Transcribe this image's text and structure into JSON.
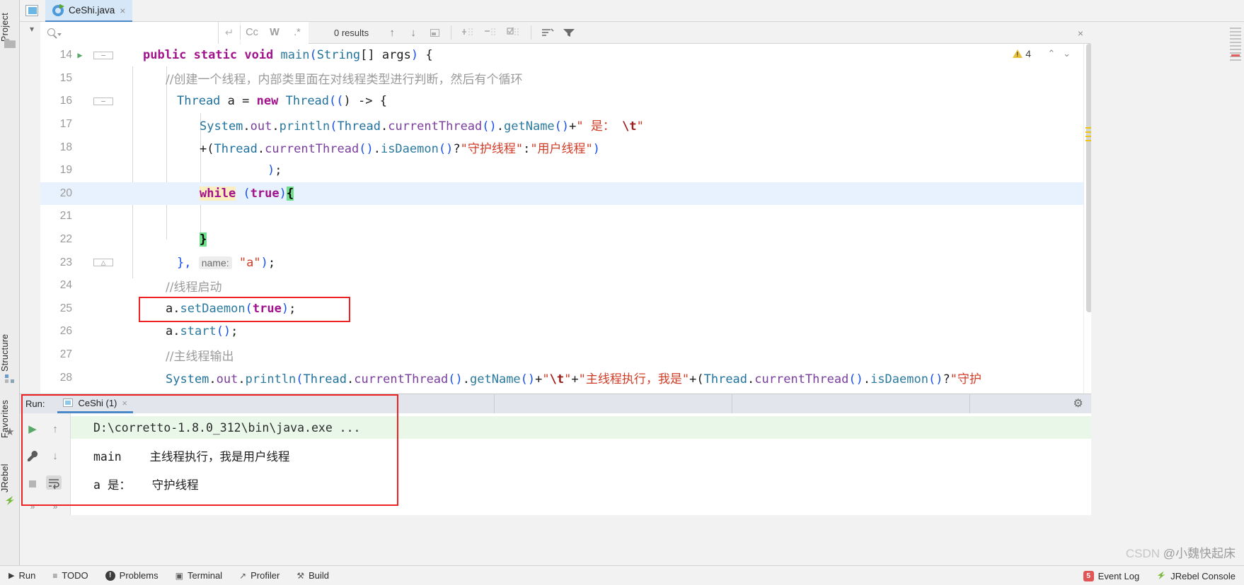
{
  "window": {
    "left_strip": {
      "project_label": "Project",
      "structure_label": "Structure",
      "favorites_label": "Favorites",
      "jrebel_label": "JRebel"
    }
  },
  "tabs": [
    {
      "label": "CeShi.java",
      "close": "×",
      "active": true
    }
  ],
  "find_toolbar": {
    "search_value": "",
    "search_placeholder": "",
    "return_icon": "↵",
    "match_case": "Cc",
    "words": "W",
    "regex": ".*",
    "results": "0 results",
    "prev_icon": "↑",
    "next_icon": "↓",
    "select_in_scope_icon": "▢",
    "add_line_icon": "+",
    "remove_line_icon": "−",
    "toggle_line_icon": "☑",
    "filter_list_icon": "≡",
    "filter_icon": "▼",
    "close_icon": "×"
  },
  "editor": {
    "warning_count": "4",
    "warning_up": "⌃",
    "warning_down": "⌄",
    "lines": [
      {
        "no": "14",
        "run_marker": "▶",
        "fold": "−",
        "indent": 0,
        "highlight": false,
        "tokens": [
          {
            "t": "public",
            "c": "kw"
          },
          {
            "t": " ",
            "c": "op"
          },
          {
            "t": "static",
            "c": "kw"
          },
          {
            "t": " ",
            "c": "op"
          },
          {
            "t": "void",
            "c": "kw"
          },
          {
            "t": " ",
            "c": "op"
          },
          {
            "t": "main",
            "c": "mth"
          },
          {
            "t": "(",
            "c": "brk"
          },
          {
            "t": "String",
            "c": "ty"
          },
          {
            "t": "[] ",
            "c": "op"
          },
          {
            "t": "args",
            "c": "id"
          },
          {
            "t": ")",
            "c": "brk"
          },
          {
            "t": " {",
            "c": "op"
          }
        ]
      },
      {
        "no": "15",
        "run_marker": "",
        "fold": "",
        "indent": 1,
        "highlight": false,
        "tokens": [
          {
            "t": "//创建一个线程，内部类里面在对线程类型进行判断，然后有个循环",
            "c": "cmt"
          }
        ]
      },
      {
        "no": "16",
        "run_marker": "",
        "fold": "−",
        "indent": 1,
        "highlight": false,
        "tokens": [
          {
            "t": "Thread",
            "c": "ty"
          },
          {
            "t": " ",
            "c": "op"
          },
          {
            "t": "a",
            "c": "id"
          },
          {
            "t": " = ",
            "c": "op"
          },
          {
            "t": "new",
            "c": "kw"
          },
          {
            "t": " ",
            "c": "op"
          },
          {
            "t": "Thread",
            "c": "ty"
          },
          {
            "t": "((",
            "c": "brk"
          },
          {
            "t": ") -> {",
            "c": "op"
          }
        ]
      },
      {
        "no": "17",
        "run_marker": "",
        "fold": "",
        "indent": 2,
        "highlight": false,
        "tokens": [
          {
            "t": "System",
            "c": "ty"
          },
          {
            "t": ".",
            "c": "op"
          },
          {
            "t": "out",
            "c": "fld"
          },
          {
            "t": ".",
            "c": "op"
          },
          {
            "t": "println",
            "c": "mth"
          },
          {
            "t": "(",
            "c": "brk"
          },
          {
            "t": "Thread",
            "c": "ty"
          },
          {
            "t": ".",
            "c": "op"
          },
          {
            "t": "currentThread",
            "c": "fld"
          },
          {
            "t": "()",
            "c": "brk"
          },
          {
            "t": ".",
            "c": "op"
          },
          {
            "t": "getName",
            "c": "mth"
          },
          {
            "t": "()",
            "c": "brk"
          },
          {
            "t": "+",
            "c": "op"
          },
          {
            "t": "\" 是： ",
            "c": "str"
          },
          {
            "t": "\\t",
            "c": "esc"
          },
          {
            "t": "\"",
            "c": "str"
          }
        ]
      },
      {
        "no": "18",
        "run_marker": "",
        "fold": "",
        "indent": 2,
        "highlight": false,
        "tokens": [
          {
            "t": "+(",
            "c": "op"
          },
          {
            "t": "Thread",
            "c": "ty"
          },
          {
            "t": ".",
            "c": "op"
          },
          {
            "t": "currentThread",
            "c": "fld"
          },
          {
            "t": "()",
            "c": "brk"
          },
          {
            "t": ".",
            "c": "op"
          },
          {
            "t": "isDaemon",
            "c": "mth"
          },
          {
            "t": "()",
            "c": "brk"
          },
          {
            "t": "?",
            "c": "op"
          },
          {
            "t": "\"守护线程\"",
            "c": "str"
          },
          {
            "t": ":",
            "c": "op"
          },
          {
            "t": "\"用户线程\"",
            "c": "str"
          },
          {
            "t": ")",
            "c": "brk"
          }
        ]
      },
      {
        "no": "19",
        "run_marker": "",
        "fold": "",
        "indent": 4,
        "highlight": false,
        "tokens": [
          {
            "t": ")",
            "c": "brk"
          },
          {
            "t": ";",
            "c": "op"
          }
        ]
      },
      {
        "no": "20",
        "run_marker": "",
        "fold": "",
        "indent": 2,
        "highlight": true,
        "tokens": [
          {
            "t": "while",
            "c": "kw searchhl"
          },
          {
            "t": " ",
            "c": "op"
          },
          {
            "t": "(",
            "c": "brk"
          },
          {
            "t": "true",
            "c": "kw"
          },
          {
            "t": ")",
            "c": "brk"
          },
          {
            "t": "{",
            "c": "brace-hl"
          }
        ]
      },
      {
        "no": "21",
        "run_marker": "",
        "fold": "",
        "indent": 0,
        "highlight": false,
        "tokens": []
      },
      {
        "no": "22",
        "run_marker": "",
        "fold": "",
        "indent": 2,
        "highlight": false,
        "tokens": [
          {
            "t": "}",
            "c": "brace-hl"
          }
        ]
      },
      {
        "no": "23",
        "run_marker": "",
        "fold": "△",
        "indent": 1,
        "highlight": false,
        "tokens": [
          {
            "t": "},",
            "c": "brk"
          },
          {
            "t": " ",
            "c": "op"
          },
          {
            "t": "name:",
            "c": "inlay"
          },
          {
            "t": " ",
            "c": "op"
          },
          {
            "t": "\"a\"",
            "c": "str"
          },
          {
            "t": ")",
            "c": "brk"
          },
          {
            "t": ";",
            "c": "op"
          }
        ]
      },
      {
        "no": "24",
        "run_marker": "",
        "fold": "",
        "indent": 1,
        "highlight": false,
        "tokens": [
          {
            "t": "//线程启动",
            "c": "cmt"
          }
        ]
      },
      {
        "no": "25",
        "run_marker": "",
        "fold": "",
        "indent": 1,
        "highlight": false,
        "tokens": [
          {
            "t": "a",
            "c": "id"
          },
          {
            "t": ".",
            "c": "op"
          },
          {
            "t": "setDaemon",
            "c": "mth"
          },
          {
            "t": "(",
            "c": "brk"
          },
          {
            "t": "true",
            "c": "kw"
          },
          {
            "t": ")",
            "c": "brk"
          },
          {
            "t": ";",
            "c": "op"
          }
        ]
      },
      {
        "no": "26",
        "run_marker": "",
        "fold": "",
        "indent": 1,
        "highlight": false,
        "tokens": [
          {
            "t": "a",
            "c": "id"
          },
          {
            "t": ".",
            "c": "op"
          },
          {
            "t": "start",
            "c": "mth"
          },
          {
            "t": "()",
            "c": "brk"
          },
          {
            "t": ";",
            "c": "op"
          }
        ]
      },
      {
        "no": "27",
        "run_marker": "",
        "fold": "",
        "indent": 1,
        "highlight": false,
        "tokens": [
          {
            "t": "//主线程输出",
            "c": "cmt"
          }
        ]
      },
      {
        "no": "28",
        "run_marker": "",
        "fold": "",
        "indent": 1,
        "highlight": false,
        "tokens": [
          {
            "t": "System",
            "c": "ty"
          },
          {
            "t": ".",
            "c": "op"
          },
          {
            "t": "out",
            "c": "fld"
          },
          {
            "t": ".",
            "c": "op"
          },
          {
            "t": "println",
            "c": "mth"
          },
          {
            "t": "(",
            "c": "brk"
          },
          {
            "t": "Thread",
            "c": "ty"
          },
          {
            "t": ".",
            "c": "op"
          },
          {
            "t": "currentThread",
            "c": "fld"
          },
          {
            "t": "()",
            "c": "brk"
          },
          {
            "t": ".",
            "c": "op"
          },
          {
            "t": "getName",
            "c": "mth"
          },
          {
            "t": "()",
            "c": "brk"
          },
          {
            "t": "+",
            "c": "op"
          },
          {
            "t": "\"",
            "c": "str"
          },
          {
            "t": "\\t",
            "c": "esc"
          },
          {
            "t": "\"",
            "c": "str"
          },
          {
            "t": "+",
            "c": "op"
          },
          {
            "t": "\"主线程执行，我是\"",
            "c": "str"
          },
          {
            "t": "+(",
            "c": "op"
          },
          {
            "t": "Thread",
            "c": "ty"
          },
          {
            "t": ".",
            "c": "op"
          },
          {
            "t": "currentThread",
            "c": "fld"
          },
          {
            "t": "()",
            "c": "brk"
          },
          {
            "t": ".",
            "c": "op"
          },
          {
            "t": "isDaemon",
            "c": "mth"
          },
          {
            "t": "()",
            "c": "brk"
          },
          {
            "t": "?",
            "c": "op"
          },
          {
            "t": "\"守护",
            "c": "str"
          }
        ]
      }
    ]
  },
  "run_window": {
    "label": "Run:",
    "tab_label": "CeShi (1)",
    "tab_close": "×",
    "settings_icon": "⚙",
    "toolbar": {
      "rerun": "▶",
      "up": "↑",
      "down": "↓",
      "wrench": "⚒",
      "stop": "■",
      "soft_wrap": "↩",
      "more_left": "»",
      "more_right": "»"
    },
    "console_lines": [
      {
        "text": "D:\\corretto-1.8.0_312\\bin\\java.exe ...",
        "highlight": true
      },
      {
        "text": "main    主线程执行，我是用户线程",
        "highlight": false
      },
      {
        "text": "a 是：   守护线程",
        "highlight": false
      }
    ]
  },
  "status_bar": {
    "items": [
      {
        "icon": "▶",
        "label": "Run"
      },
      {
        "icon": "≡",
        "label": "TODO"
      },
      {
        "icon": "!",
        "label": "Problems"
      },
      {
        "icon": "▣",
        "label": "Terminal"
      },
      {
        "icon": "↗",
        "label": "Profiler"
      },
      {
        "icon": "⚒",
        "label": "Build"
      }
    ],
    "event_log": {
      "badge": "5",
      "label": "Event Log"
    },
    "jrebel_console": "JRebel Console"
  },
  "watermark": {
    "csdn": "CSDN",
    "user": "@小魏快起床"
  },
  "colors": {
    "accent": "#4a88c7",
    "tab_active_bg": "#d6e7f8",
    "highlight_line": "#e8f2fe",
    "search_highlight": "#fbeec0",
    "brace_highlight": "#6ee08b",
    "red_box": "#ee2222",
    "console_highlight": "#e8f7e8",
    "string": "#d13c26",
    "keyword": "#a1128c"
  }
}
